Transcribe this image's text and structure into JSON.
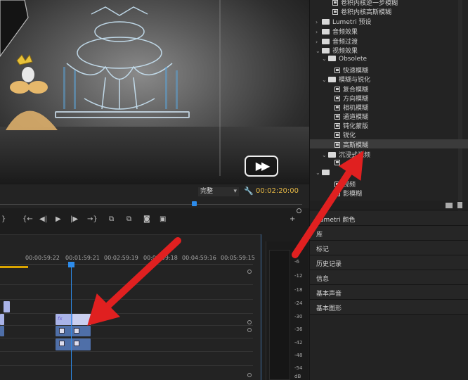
{
  "monitor": {
    "fit_value": "完整",
    "timecode": "00:02:20:00",
    "play_glyph": "▶▶"
  },
  "timeline": {
    "timecodes": [
      "00:00:59:22",
      "00:01:59:21",
      "00:02:59:19",
      "00:03:59:18",
      "00:04:59:16",
      "00:05:59:15"
    ],
    "clip_fx_badge": "fx"
  },
  "meter": {
    "db_labels": [
      "-6",
      "-12",
      "-18",
      "-24",
      "-30",
      "-36",
      "-42",
      "-48",
      "-54",
      "dB"
    ]
  },
  "effects_tree": [
    {
      "label": "卷积内核逆一步模糊",
      "level": 3,
      "kind": "effect"
    },
    {
      "label": "卷积内核高斯模糊",
      "level": 3,
      "kind": "effect"
    },
    {
      "label": "Lumetri 预设",
      "level": 0,
      "kind": "folder",
      "twist": "›"
    },
    {
      "label": "音频效果",
      "level": 0,
      "kind": "folder",
      "twist": "›"
    },
    {
      "label": "音频过渡",
      "level": 0,
      "kind": "folder",
      "twist": "›"
    },
    {
      "label": "视频效果",
      "level": 0,
      "kind": "folder",
      "twist": "⌄"
    },
    {
      "label": "Obsolete",
      "level": 1,
      "kind": "folder",
      "twist": "⌄"
    },
    {
      "label": "快速模糊",
      "level": 2,
      "kind": "effect"
    },
    {
      "label": "模糊与锐化",
      "level": 1,
      "kind": "folder",
      "twist": "⌄"
    },
    {
      "label": "复合模糊",
      "level": 2,
      "kind": "effect"
    },
    {
      "label": "方向模糊",
      "level": 2,
      "kind": "effect"
    },
    {
      "label": "相机模糊",
      "level": 2,
      "kind": "effect"
    },
    {
      "label": "通道模糊",
      "level": 2,
      "kind": "effect"
    },
    {
      "label": "钝化蒙版",
      "level": 2,
      "kind": "effect"
    },
    {
      "label": "锐化",
      "level": 2,
      "kind": "effect"
    },
    {
      "label": "高斯模糊",
      "level": 2,
      "kind": "effect",
      "selected": true
    },
    {
      "label": "沉浸式视频",
      "level": 1,
      "kind": "folder",
      "twist": "⌄"
    },
    {
      "label": "",
      "level": 2,
      "kind": "effect"
    },
    {
      "label": "",
      "level": 1,
      "kind": "folder",
      "twist": "⌄"
    },
    {
      "label": "视频",
      "level": 2,
      "kind": "effect"
    },
    {
      "label": "影模糊",
      "level": 2,
      "kind": "effect"
    }
  ],
  "panels": [
    "Lumetri 颜色",
    "库",
    "标记",
    "历史记录",
    "信息",
    "基本声音",
    "基本图形"
  ],
  "colors": {
    "timecode": "#e6b844",
    "playhead": "#2d8ceb",
    "annotation_arrow": "#e02020",
    "video_clip": "#a9b3e8",
    "audio_clip": "#4f6fa8"
  }
}
